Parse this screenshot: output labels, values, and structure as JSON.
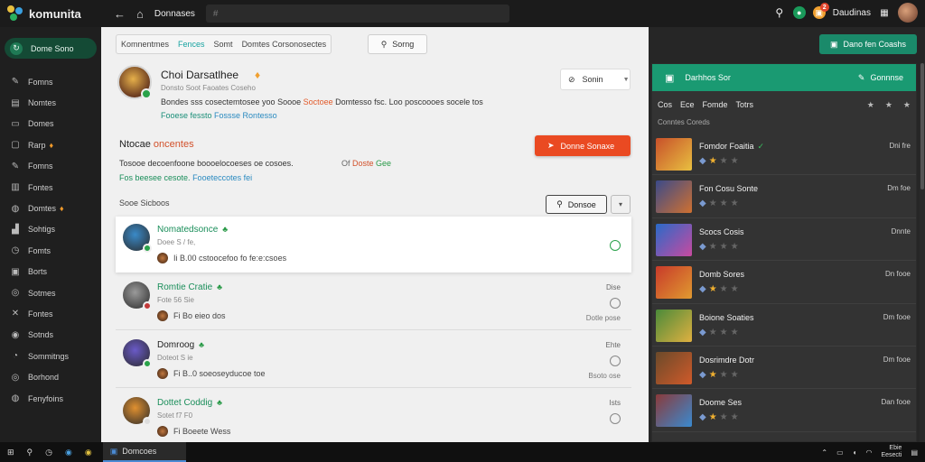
{
  "app": {
    "name": "komunita"
  },
  "topbar": {
    "nav_label": "Donnases",
    "search_placeholder": "#",
    "user_name": "Daudinas",
    "notif_count": "2"
  },
  "sidebar": {
    "cta": "Dome Sono",
    "items": [
      {
        "label": "Fomns",
        "icon": "pin-icon",
        "glyph": "✎"
      },
      {
        "label": "Nomtes",
        "icon": "inbox-icon",
        "glyph": "▤"
      },
      {
        "label": "Domes",
        "icon": "monitor-icon",
        "glyph": "▭"
      },
      {
        "label": "Rarp",
        "icon": "chat-icon",
        "glyph": "▢",
        "fire": true
      },
      {
        "label": "Fomns",
        "icon": "pen-icon",
        "glyph": "✎"
      },
      {
        "label": "Fontes",
        "icon": "chart-icon",
        "glyph": "▥"
      },
      {
        "label": "Domtes",
        "icon": "globe-icon",
        "glyph": "◍",
        "fire": true
      },
      {
        "label": "Sohtigs",
        "icon": "bars-icon",
        "glyph": "▟"
      },
      {
        "label": "Fomts",
        "icon": "clock-icon",
        "glyph": "◷"
      },
      {
        "label": "Borts",
        "icon": "doc-icon",
        "glyph": "▣"
      },
      {
        "label": "Sotmes",
        "icon": "target-icon",
        "glyph": "◎"
      },
      {
        "label": "Fontes",
        "icon": "tools-icon",
        "glyph": "✕"
      },
      {
        "label": "Sotnds",
        "icon": "settings-icon",
        "glyph": "◉"
      },
      {
        "label": "Sommitngs",
        "icon": "gauge-icon",
        "glyph": "◔"
      },
      {
        "label": "Borhond",
        "icon": "save-icon",
        "glyph": "◎"
      },
      {
        "label": "Fenyfoins",
        "icon": "help-icon",
        "glyph": "◍"
      }
    ]
  },
  "main": {
    "tabs": [
      "Komnentmes",
      "Fences",
      "Somt",
      "Domtes Corsonosectes"
    ],
    "active_tab": 1,
    "sort_label": "Sorng",
    "profile": {
      "name": "Choi Darsatlhee",
      "sub": "Donsto Soot   Faoates Coseho",
      "bio_a": "Bondes sss cosectemtosee yoo Soooe ",
      "bio_hl": "Soctoee",
      "bio_b": " Domtesso fsc. Loo poscoooes socele tos",
      "tag_a": "Fooese fessto",
      "tag_b": "Fossse Rontesso"
    },
    "join_label": "Sonin",
    "section": {
      "title_a": "Ntocae ",
      "title_b": "oncentes",
      "text": "Tosooe decoenfoone  boooelocoeses oe cosoes.",
      "text2_a": "Fos beesee cesote. ",
      "text2_b": "Fooeteccotes fei",
      "meta_a": "Of ",
      "meta_b": "Doste",
      "meta_c": " Gee"
    },
    "cta_label": "Donne Sonaxe",
    "list_label": "Sooe Sicboos",
    "list_btn": "Donsoe",
    "posts": [
      {
        "title": "Nomatedsonce",
        "sub": "Doee S / fe,",
        "foot": "Ii   B.00   cstoocefoo fo fe:e:csoes",
        "right": "",
        "time": "",
        "title_color": "#1a8e5a",
        "av": "#3a8ac8",
        "dot": "#2aa24a",
        "status": "#2aa24a"
      },
      {
        "title": "Romtie  Cratie",
        "sub": "Fote  56 Sie",
        "foot": "Fi   Bo  eieo dos",
        "right": "Dise",
        "time": "Dotle pose",
        "title_color": "#1a8e5a",
        "av": "#9a9a9a",
        "dot": "#c23a3a",
        "status": "#888"
      },
      {
        "title": "Domroog",
        "sub": "Doteot  S ie",
        "foot": "Fi   B..0  soeoseyducoe toe",
        "right": "Ehte",
        "time": "Bsoto ose",
        "title_color": "#222",
        "av": "#6a5ac8",
        "dot": "#2aa24a",
        "status": "#888"
      },
      {
        "title": "Dottet  Coddig",
        "sub": "Sotet  f7 F0",
        "foot": "Fi   Boeete  Wess",
        "right": "Ists",
        "time": "",
        "title_color": "#1a8e5a",
        "av": "#e09030",
        "dot": "#ddd",
        "status": "#888"
      }
    ]
  },
  "rpanel": {
    "top_btn": "Dano fen Coashs",
    "header_a": "Darhhos Sor",
    "header_b": "Gonnnse",
    "tabs": [
      "Cos",
      "Ece",
      "Fomde",
      "Totrs"
    ],
    "sub": "Conntes Coreds",
    "rows": [
      {
        "name": "Fomdor Foaitia",
        "meta": "Dni fre",
        "stars": 1,
        "badge": true,
        "c1": "#c8502a",
        "c2": "#e8c040"
      },
      {
        "name": "Fon Cosu Sonte",
        "meta": "Dm foe",
        "stars": 0,
        "badge": false,
        "c1": "#3a4a8a",
        "c2": "#d07030"
      },
      {
        "name": "Scocs Cosis",
        "meta": "Dnnte",
        "stars": 0,
        "badge": false,
        "c1": "#2a6ac8",
        "c2": "#c84aa0"
      },
      {
        "name": "Domb Sores",
        "meta": "Dn fooe",
        "stars": 1,
        "badge": false,
        "c1": "#c83a2a",
        "c2": "#e09a30"
      },
      {
        "name": "Boione Soaties",
        "meta": "Dm fooe",
        "stars": 0,
        "badge": false,
        "c1": "#4a8a3a",
        "c2": "#e0b040"
      },
      {
        "name": "Dosrimdre Dotr",
        "meta": "Dm fooe",
        "stars": 1,
        "badge": false,
        "c1": "#6a4a2a",
        "c2": "#d05a2a"
      },
      {
        "name": "Doome Ses",
        "meta": "Dan fooe",
        "stars": 1,
        "badge": false,
        "c1": "#8a3a3a",
        "c2": "#3a8ad0"
      }
    ]
  },
  "taskbar": {
    "app": "Domcoes",
    "time": "Ebie",
    "date": "Eesecti"
  }
}
